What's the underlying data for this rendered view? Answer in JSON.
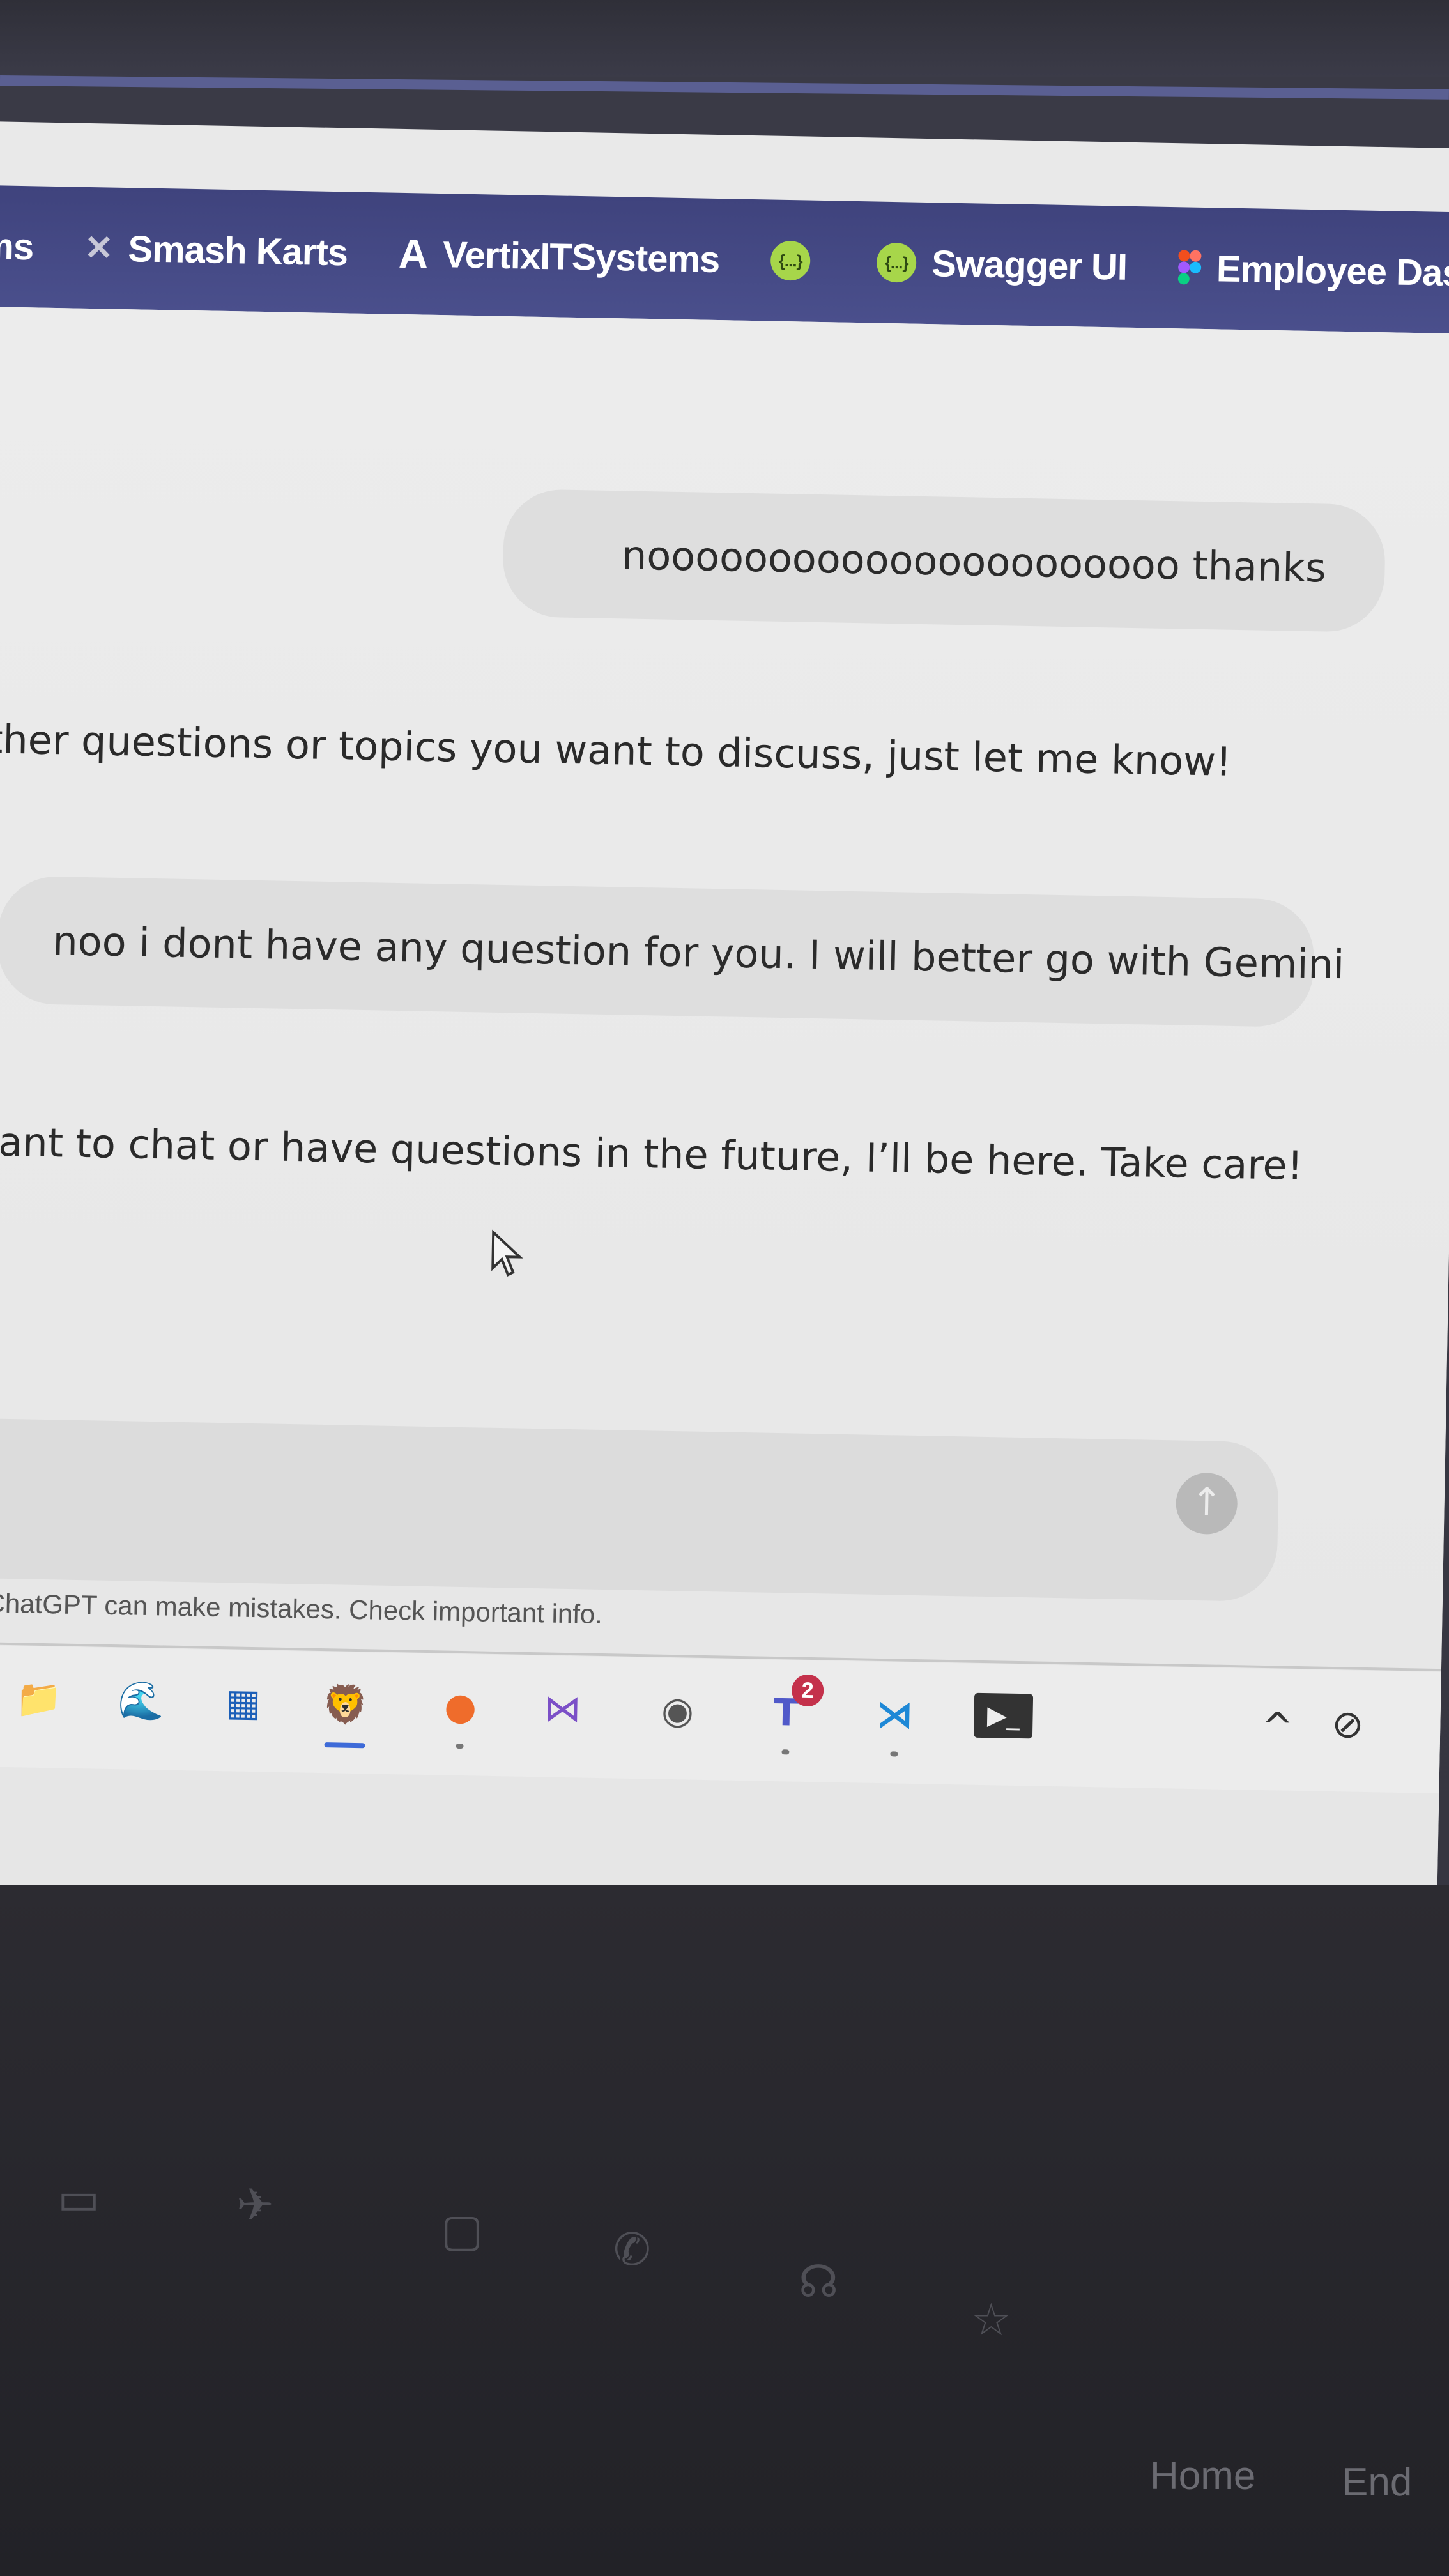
{
  "bookmarks": [
    {
      "label": "ms",
      "icon": "none"
    },
    {
      "label": "Smash Karts",
      "icon": "bunny-icon"
    },
    {
      "label": "VertixITSystems",
      "icon": "letter-a-icon"
    },
    {
      "label": "",
      "icon": "braces-icon"
    },
    {
      "label": "Swagger UI",
      "icon": "braces-icon"
    },
    {
      "label": "Employee Dashbo",
      "icon": "figma-icon"
    }
  ],
  "chat": {
    "messages": [
      {
        "role": "user",
        "text": "noooooooooooooooooooooo thanks"
      },
      {
        "role": "assistant",
        "text": "other questions or topics you want to discuss, just let me know!"
      },
      {
        "role": "user",
        "text": "noo i dont have any question for you. I will better go with Gemini"
      },
      {
        "role": "assistant",
        "text": "want to chat or have questions in the future, I’ll be here. Take care!"
      }
    ],
    "disclaimer": "ChatGPT can make mistakes. Check important info.",
    "send_icon": "↑"
  },
  "taskbar": {
    "apps": [
      {
        "name": "file-explorer-icon",
        "glyph": "📁"
      },
      {
        "name": "edge-icon",
        "glyph": "🌊"
      },
      {
        "name": "store-icon",
        "glyph": "▦"
      },
      {
        "name": "brave-icon",
        "glyph": "🦁"
      },
      {
        "name": "postman-icon",
        "glyph": "●"
      },
      {
        "name": "visual-studio-icon",
        "glyph": "⋈"
      },
      {
        "name": "browser-icon",
        "glyph": "◉"
      },
      {
        "name": "teams-icon",
        "glyph": "T",
        "badge": "2"
      },
      {
        "name": "vscode-icon",
        "glyph": "⋊"
      },
      {
        "name": "terminal-icon",
        "glyph": "▶_"
      }
    ],
    "tray_chevron": "^",
    "tray_icon": "⊘"
  },
  "keyboard": {
    "home": "Home",
    "end": "End"
  },
  "colors": {
    "bookmark_bar": "#4a4f8c",
    "chat_bg": "#ececec",
    "bubble_bg": "#dedede",
    "teams_badge": "#c4314b"
  }
}
